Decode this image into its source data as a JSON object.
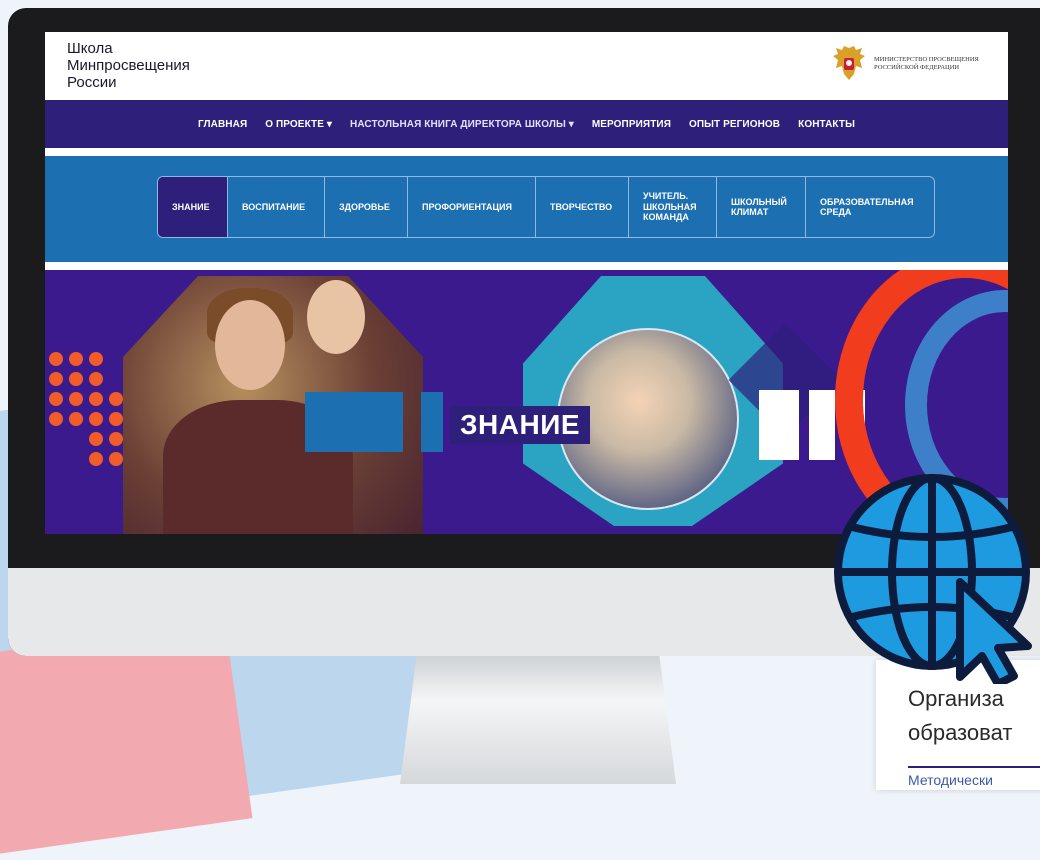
{
  "site": {
    "school_title": "Школа\nМинпросвещения\nРоссии",
    "ministry_text": "МИНИСТЕРСТВО ПРОСВЕЩЕНИЯ РОССИЙСКОЙ ФЕДЕРАЦИИ"
  },
  "top_nav": [
    {
      "label": "ГЛАВНАЯ"
    },
    {
      "label": "О ПРОЕКТЕ ▾"
    },
    {
      "label": "НАСТОЛЬНАЯ КНИГА ДИРЕКТОРА ШКОЛЫ ▾"
    },
    {
      "label": "МЕРОПРИЯТИЯ"
    },
    {
      "label": "ОПЫТ РЕГИОНОВ"
    },
    {
      "label": "КОНТАКТЫ"
    }
  ],
  "tabs": [
    {
      "label": "ЗНАНИЕ",
      "active": true
    },
    {
      "label": "ВОСПИТАНИЕ"
    },
    {
      "label": "ЗДОРОВЬЕ"
    },
    {
      "label": "ПРОФОРИЕНТАЦИЯ"
    },
    {
      "label": "ТВОРЧЕСТВО"
    },
    {
      "label": "УЧИТЕЛЬ.\nШКОЛЬНАЯ\nКОМАНДА"
    },
    {
      "label": "ШКОЛЬНЫЙ\nКЛИМАТ"
    },
    {
      "label": "ОБРАЗОВАТЕЛЬНАЯ\nСРЕДА"
    }
  ],
  "hero": {
    "title": "ЗНАНИЕ"
  },
  "card": {
    "line1": "Организа",
    "line2": "образоват",
    "sub": "Методически"
  },
  "colors": {
    "nav": "#2e1f7a",
    "band": "#1c6fb1",
    "hero": "#3a1a8c",
    "accent_orange": "#f25c2a",
    "accent_red": "#f23c1e",
    "globe": "#1e9be0"
  },
  "icons": {
    "globe": "globe-icon",
    "cursor": "cursor-arrow-icon",
    "emblem": "coat-of-arms-icon"
  }
}
